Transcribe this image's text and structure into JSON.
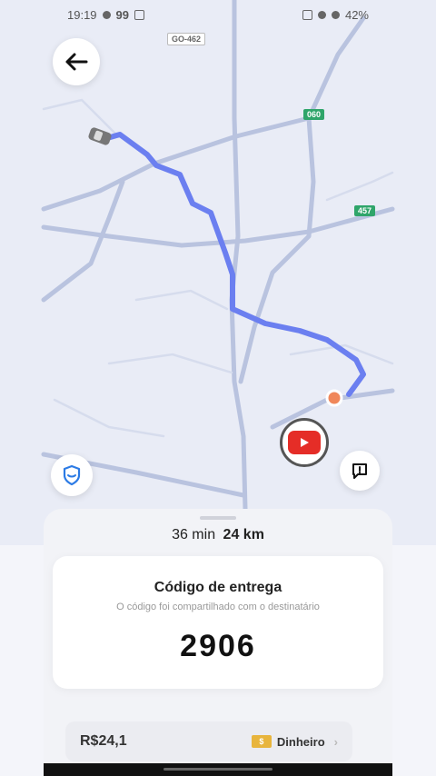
{
  "status": {
    "time": "19:19",
    "notif_count": "99",
    "battery": "42%"
  },
  "map": {
    "road_labels": [
      "GO-462",
      "060",
      "457"
    ],
    "route_color": "#6b7ff0",
    "destination_color": "#f0875a"
  },
  "buttons": {
    "back_icon": "arrow-left-icon",
    "shield_icon": "shield-icon",
    "report_icon": "alert-icon",
    "youtube_icon": "youtube-icon"
  },
  "trip": {
    "duration": "36 min",
    "distance": "24 km"
  },
  "delivery_code": {
    "title": "Código de entrega",
    "subtitle": "O código foi compartilhado com o destinatário",
    "code": "2906"
  },
  "payment": {
    "fare": "R$24,1",
    "method": "Dinheiro",
    "cash_icon_text": "$"
  }
}
